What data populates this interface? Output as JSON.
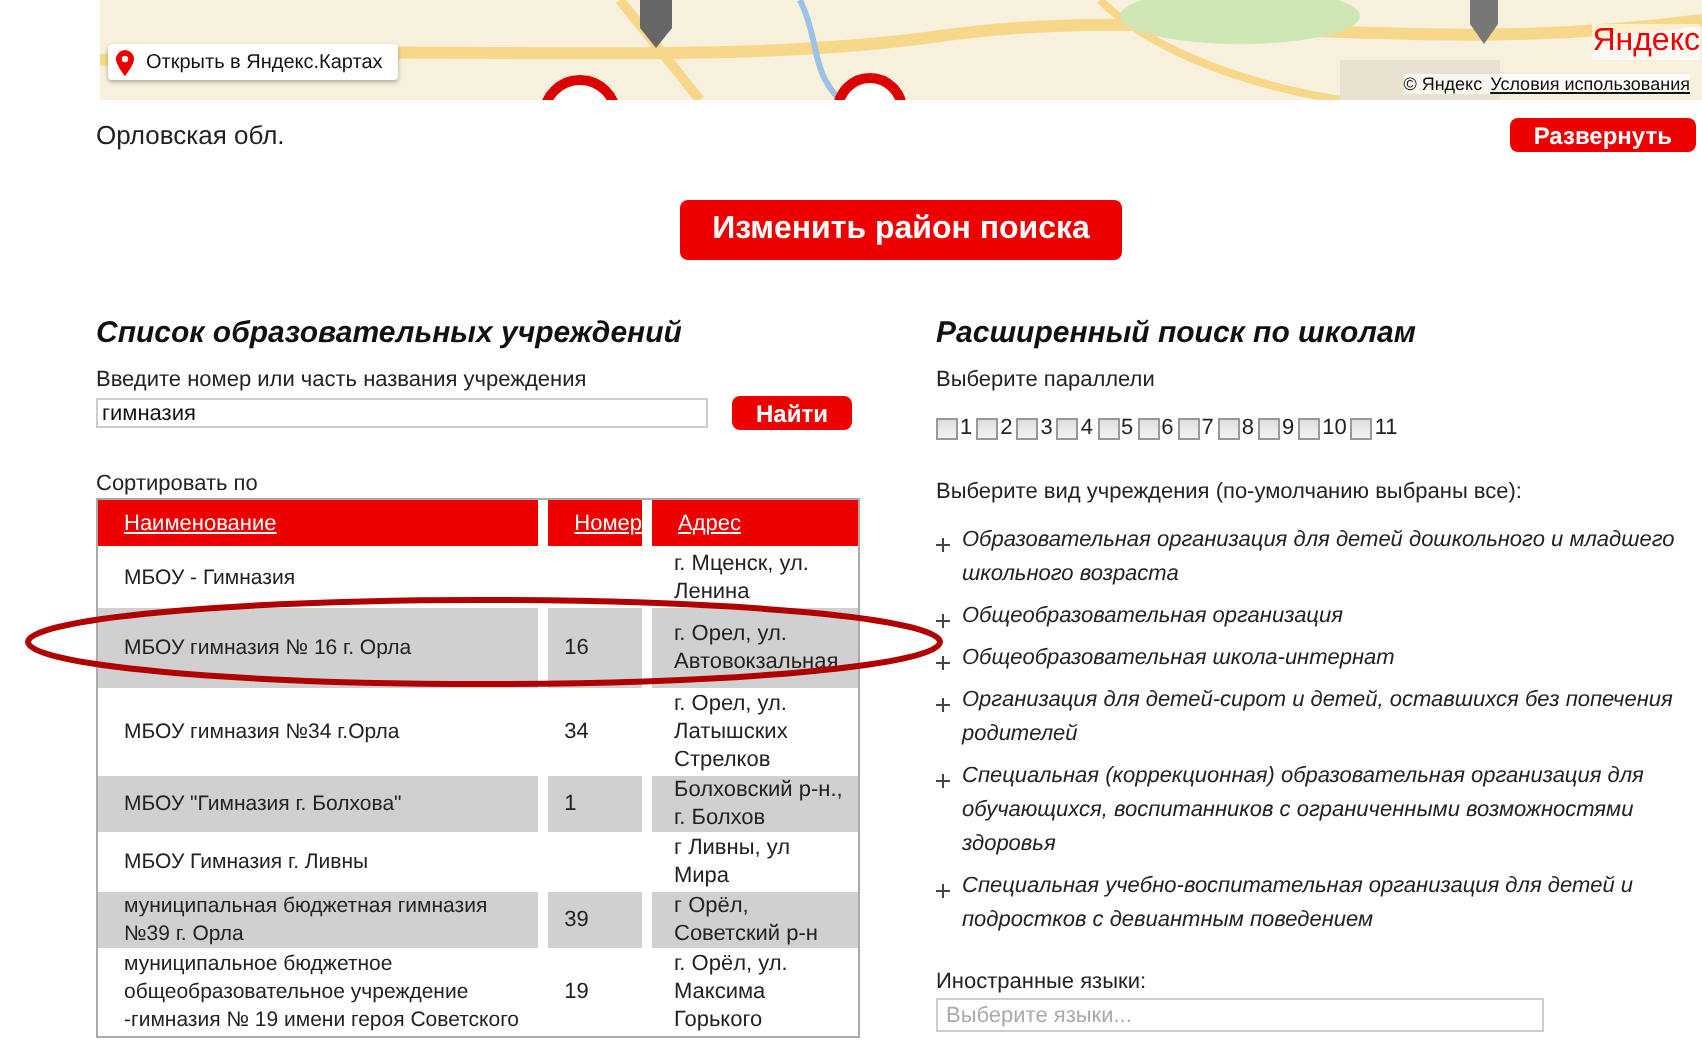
{
  "map": {
    "open_link": "Открыть в Яндекс.Картах",
    "copyright": "© Яндекс",
    "terms": "Условия использования",
    "logo": "Яндекс"
  },
  "region": "Орловская обл.",
  "expand_button": "Развернуть",
  "change_area_button": "Изменить район поиска",
  "institutions": {
    "title": "Список образовательных учреждений",
    "search_label": "Введите номер или часть названия учреждения",
    "search_value": "гимназия",
    "find_button": "Найти",
    "sort_label": "Сортировать по",
    "columns": [
      "Наименование",
      "Номер",
      "Адрес"
    ],
    "rows": [
      {
        "name": "МБОУ - Гимназия",
        "address": "г. Мценск, ул. Ленина"
      },
      {
        "name": "МБОУ гимназия № 16 г. Орла",
        "number": "16",
        "address": "г. Орел, ул. Автовокзальная"
      },
      {
        "name": "МБОУ гимназия №34 г.Орла",
        "number": "34",
        "address": "г. Орел, ул. Латышских Стрелков"
      },
      {
        "name": "МБОУ \"Гимназия г. Болхова\"",
        "number": "1",
        "address": "Болховский р-н., г. Болхов"
      },
      {
        "name": "МБОУ Гимназия г. Ливны",
        "address": "г Ливны, ул Мира"
      },
      {
        "name": "муниципальная бюджетная гимназия №39 г. Орла",
        "number": "39",
        "address": "г Орёл, Советский р-н"
      },
      {
        "name": "муниципальное бюджетное общеобразовательное учреждение -гимназия № 19 имени героя Советского",
        "number": "19",
        "address": "г. Орёл, ул. Максима Горького"
      }
    ]
  },
  "advanced_search": {
    "title": "Расширенный поиск по школам",
    "grades_label": "Выберите параллели",
    "grades": [
      {
        "label": "1",
        "checked": false
      },
      {
        "label": "2",
        "checked": false
      },
      {
        "label": "3",
        "checked": false
      },
      {
        "label": "4",
        "checked": false
      },
      {
        "label": "5",
        "checked": false
      },
      {
        "label": "6",
        "checked": false
      },
      {
        "label": "7",
        "checked": false
      },
      {
        "label": "8",
        "checked": false
      },
      {
        "label": "9",
        "checked": false
      },
      {
        "label": "10",
        "checked": false
      },
      {
        "label": "11",
        "checked": false
      }
    ],
    "types_label": "Выберите вид учреждения (по-умолчанию выбраны все):",
    "types": [
      "Образовательная организация для детей дошкольного и младшего школьного возраста",
      "Общеобразовательная организация",
      "Общеобразовательная школа-интернат",
      "Организация для детей-сирот и детей, оставшихся без попечения родителей",
      "Специальная (коррекционная) образовательная организация для обучающихся, воспитанников с ограниченными возможностями здоровья",
      "Специальная учебно-воспитательная организация для детей и подростков с девиантным поведением"
    ],
    "languages_label": "Иностранные языки:",
    "languages_placeholder": "Выберите языки..."
  }
}
